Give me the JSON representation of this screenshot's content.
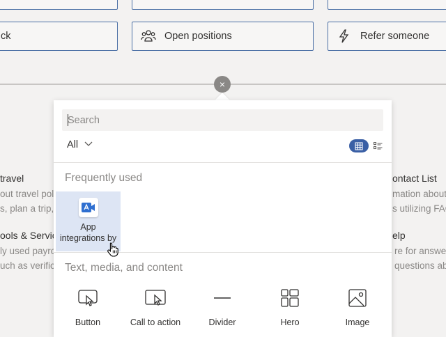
{
  "background": {
    "tiles_row1": [
      "",
      "",
      ""
    ],
    "tiles_row2": [
      {
        "label": "ck",
        "icon": "feedback-icon"
      },
      {
        "label": "Open positions",
        "icon": "people-group-icon"
      },
      {
        "label": "Refer someone",
        "icon": "lightning-icon"
      }
    ],
    "left_items": [
      {
        "title": "travel",
        "lines": [
          "out travel pol",
          "s, plan a trip,"
        ]
      },
      {
        "title": "ools & Service",
        "lines": [
          "ly used payro",
          "uch as verific"
        ]
      }
    ],
    "right_items": [
      {
        "title": "ontact List",
        "lines": [
          "mation about",
          "s utilizing FAQ"
        ]
      },
      {
        "title": "elp",
        "lines": [
          "re for answe",
          "questions ab"
        ]
      }
    ]
  },
  "close_label": "×",
  "panel": {
    "search": {
      "placeholder": "Search",
      "value": ""
    },
    "filter": {
      "label": "All"
    },
    "frequently_used": {
      "heading": "Frequently used",
      "items": [
        {
          "label_line1": "App",
          "label_line2": "integrations by",
          "icon": "app-integrations-icon"
        }
      ]
    },
    "text_media": {
      "heading": "Text, media, and content",
      "tools": [
        {
          "label": "Button",
          "icon": "button-icon"
        },
        {
          "label": "Call to action",
          "icon": "call-to-action-icon"
        },
        {
          "label": "Divider",
          "icon": "divider-icon"
        },
        {
          "label": "Hero",
          "icon": "hero-icon"
        },
        {
          "label": "Image",
          "icon": "image-icon"
        }
      ]
    }
  },
  "colors": {
    "accent": "#3a5fa5",
    "tile_border": "#4a6fa5",
    "selected_bg": "#dde5f4"
  }
}
